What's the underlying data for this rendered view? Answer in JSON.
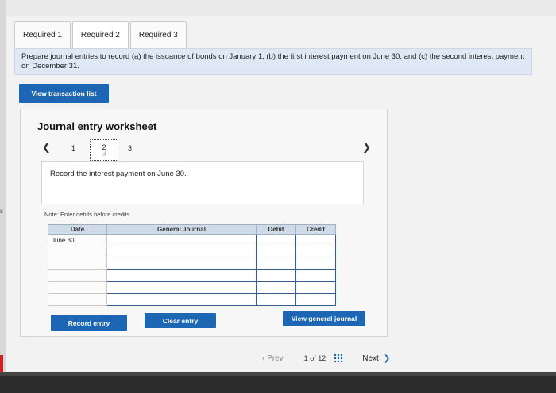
{
  "tabs": [
    {
      "label": "Required 1"
    },
    {
      "label": "Required 2"
    },
    {
      "label": "Required 3"
    }
  ],
  "instructions": "Prepare journal entries to record (a) the issuance of bonds on January 1, (b) the first interest payment on June 30, and (c) the second interest payment on December 31.",
  "view_transaction_label": "View transaction list",
  "worksheet": {
    "title": "Journal entry worksheet",
    "steps": [
      "1",
      "2",
      "3"
    ],
    "description": "Record the interest payment on June 30.",
    "note": "Note: Enter debits before credits.",
    "table": {
      "headers": {
        "date": "Date",
        "account": "General Journal",
        "debit": "Debit",
        "credit": "Credit"
      },
      "rows": [
        {
          "date": "June 30",
          "account": "",
          "debit": "",
          "credit": ""
        },
        {
          "date": "",
          "account": "",
          "debit": "",
          "credit": ""
        },
        {
          "date": "",
          "account": "",
          "debit": "",
          "credit": ""
        },
        {
          "date": "",
          "account": "",
          "debit": "",
          "credit": ""
        },
        {
          "date": "",
          "account": "",
          "debit": "",
          "credit": ""
        },
        {
          "date": "",
          "account": "",
          "debit": "",
          "credit": ""
        }
      ]
    },
    "record_label": "Record entry",
    "clear_label": "Clear entry",
    "view_general_label": "View general journal"
  },
  "pager": {
    "prev_label": "Prev",
    "page_current": "1",
    "page_of": "of",
    "page_total": "12",
    "next_label": "Next"
  },
  "side_mark": "s"
}
